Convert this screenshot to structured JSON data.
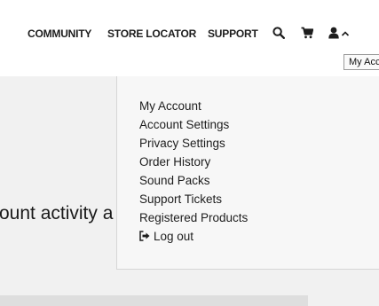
{
  "header": {
    "nav": [
      {
        "label": "COMMUNITY"
      },
      {
        "label": "STORE LOCATOR"
      },
      {
        "label": "SUPPORT"
      }
    ],
    "icons": {
      "search": "search-icon",
      "cart": "cart-icon",
      "user": "user-icon",
      "chevron": "chevron-up-icon"
    },
    "tooltip": "My Account"
  },
  "page": {
    "heading_fragment": "ount activity a"
  },
  "account_menu": {
    "items": [
      {
        "label": "My Account"
      },
      {
        "label": "Account Settings"
      },
      {
        "label": "Privacy Settings"
      },
      {
        "label": "Order History"
      },
      {
        "label": "Sound Packs"
      },
      {
        "label": "Support Tickets"
      },
      {
        "label": "Registered Products"
      }
    ],
    "logout": {
      "label": "Log out",
      "icon": "logout-icon"
    }
  },
  "colors": {
    "text": "#1d1d1d",
    "header_bg": "#ffffff",
    "page_bg": "#f1f1f1",
    "menu_bg": "#f7f7f7"
  }
}
